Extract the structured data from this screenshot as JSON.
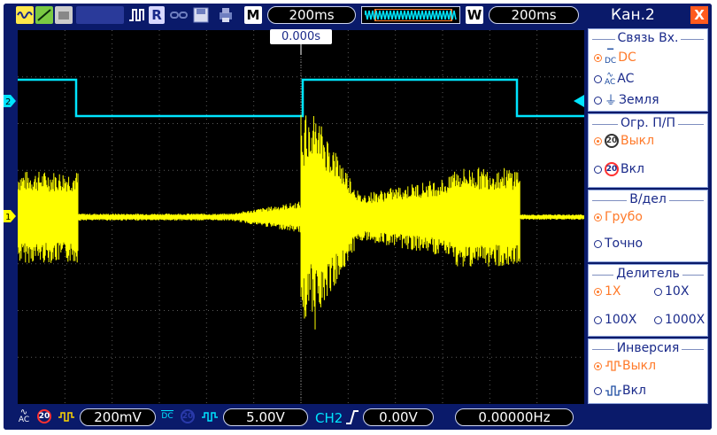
{
  "topbar": {
    "mode_letter": "M",
    "main_timebase": "200ms",
    "window_letter": "W",
    "window_timebase": "200ms",
    "run_label": "R",
    "trigger_position": "0.000s"
  },
  "channels": {
    "ch1_marker": "1",
    "ch2_marker": "2"
  },
  "bottombar": {
    "ch1_coupling": "AC",
    "ch1_limit": "20",
    "ch1_scale": "200mV",
    "ch2_coupling": "DC",
    "ch2_scale": "5.00V",
    "trigger_source": "CH2",
    "trigger_level": "0.00V",
    "frequency": "0.00000Hz"
  },
  "panel": {
    "title": "Кан.2",
    "close": "X",
    "coupling": {
      "title": "Связь  Вх.",
      "options": [
        "DC",
        "AC",
        "Земля"
      ],
      "selected": "DC"
    },
    "bw_limit": {
      "title": "Огр.  П/П",
      "badge": "20",
      "options": [
        "Выкл",
        "Вкл"
      ],
      "selected": "Выкл"
    },
    "volts_div": {
      "title": "В/дел",
      "options": [
        "Грубо",
        "Точно"
      ],
      "selected": "Грубо"
    },
    "probe": {
      "title": "Делитель",
      "options": [
        "1X",
        "10X",
        "100X",
        "1000X"
      ],
      "selected": "1X"
    },
    "invert": {
      "title": "Инверсия",
      "options": [
        "Выкл",
        "Вкл"
      ],
      "selected": "Выкл"
    }
  },
  "colors": {
    "ch1": "#ffff00",
    "ch2": "#00e5ff",
    "accent": "#ff7a2a",
    "frame": "#0a1a6a"
  }
}
